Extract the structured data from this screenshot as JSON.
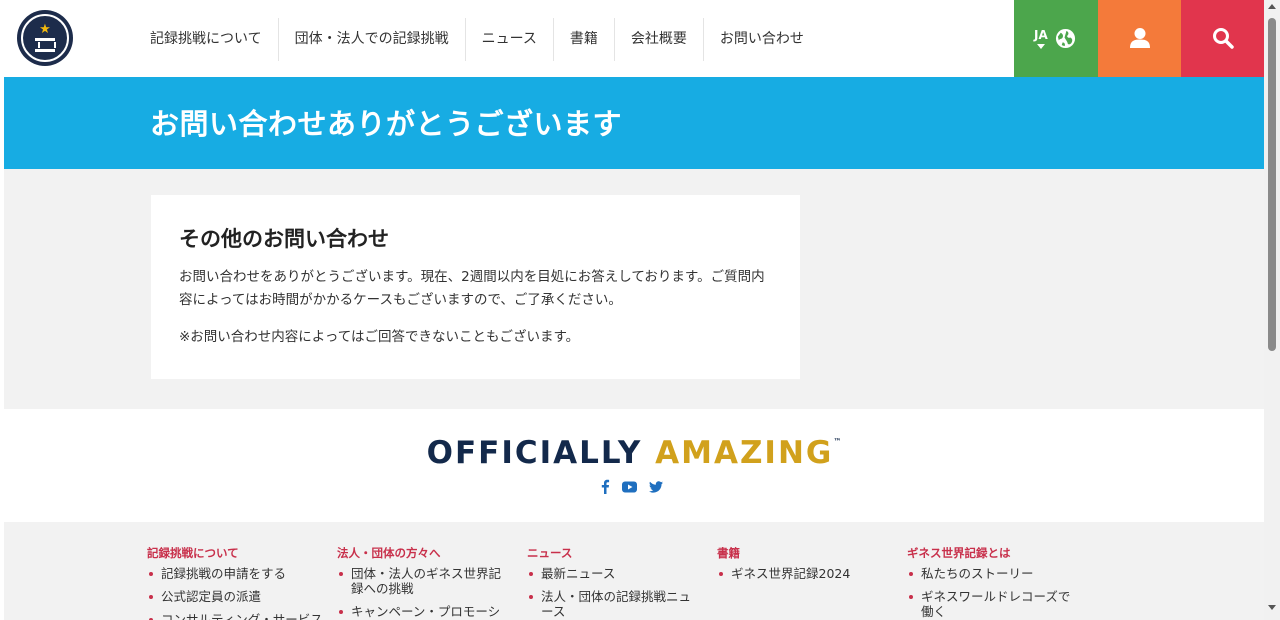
{
  "header": {
    "logo_alt": "GUINNESS WORLD RECORDS",
    "nav": [
      "記録挑戦について",
      "団体・法人での記録挑戦",
      "ニュース",
      "書籍",
      "会社概要",
      "お問い合わせ"
    ],
    "lang_code": "JA",
    "colors": {
      "lang": "#4ca64c",
      "user": "#f47a3a",
      "search": "#e1354d"
    }
  },
  "hero": {
    "title": "お問い合わせありがとうございます",
    "color": "#17ace3"
  },
  "card": {
    "heading": "その他のお問い合わせ",
    "paragraph1": "お問い合わせをありがとうございます。現在、2週間以内を目処にお答えしております。ご質問内容によってはお時間がかかるケースもございますので、ご了承ください。",
    "paragraph2": "※お問い合わせ内容によってはご回答できないこともございます。"
  },
  "tagline": {
    "part1": "OFFICIALLY",
    "part2": "AMAZING",
    "tm": "™"
  },
  "social": [
    "facebook-icon",
    "youtube-icon",
    "twitter-icon"
  ],
  "footer": {
    "columns": [
      {
        "title": "記録挑戦について",
        "items": [
          "記録挑戦の申請をする",
          "公式認定員の派遣",
          "コンサルティング・サービス"
        ]
      },
      {
        "title": "法人・団体の方々へ",
        "items": [
          "団体・法人のギネス世界記録への挑戦",
          "キャンペーン・プロモーション"
        ]
      },
      {
        "title": "ニュース",
        "items": [
          "最新ニュース",
          "法人・団体の記録挑戦ニュース"
        ]
      },
      {
        "title": "書籍",
        "items": [
          "ギネス世界記録2024"
        ]
      },
      {
        "title": "ギネス世界記録とは",
        "items": [
          "私たちのストーリー",
          "ギネスワールドレコーズで働く"
        ]
      }
    ]
  }
}
